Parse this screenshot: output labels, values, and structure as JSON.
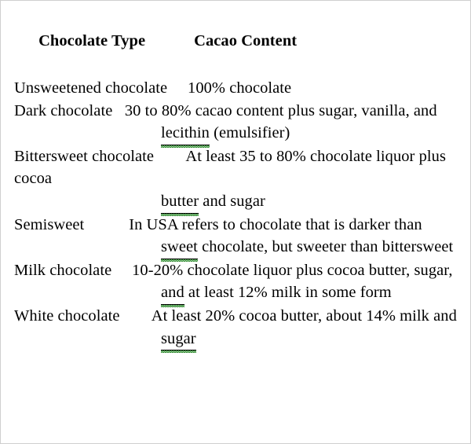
{
  "document": {
    "type": "table",
    "title_row": {
      "col1": "Chocolate Type",
      "col2": "Cacao Content"
    },
    "lines": [
      {
        "id": "line-unsweetened",
        "indent": "none",
        "segments": [
          {
            "text": "Unsweetened chocolate     100% chocolate",
            "spellcheck": false
          }
        ]
      },
      {
        "id": "line-dark-1",
        "indent": "none",
        "segments": [
          {
            "text": "Dark chocolate   30 to 80% cacao content plus sugar, vanilla, and",
            "spellcheck": false
          }
        ]
      },
      {
        "id": "line-dark-2",
        "indent": "hanging",
        "segments": [
          {
            "text": "lecithin",
            "spellcheck": true
          },
          {
            "text": " (emulsifier)",
            "spellcheck": false
          }
        ]
      },
      {
        "id": "line-bittersweet-1",
        "indent": "none",
        "segments": [
          {
            "text": "Bittersweet chocolate        At least 35 to 80% chocolate liquor plus cocoa",
            "spellcheck": false
          }
        ]
      },
      {
        "id": "line-bittersweet-2",
        "indent": "hanging",
        "segments": [
          {
            "text": "butter",
            "spellcheck": true
          },
          {
            "text": " and sugar",
            "spellcheck": false
          }
        ]
      },
      {
        "id": "line-semisweet-1",
        "indent": "none",
        "segments": [
          {
            "text": "Semisweet           In USA refers to chocolate that is darker than",
            "spellcheck": false
          }
        ]
      },
      {
        "id": "line-semisweet-2",
        "indent": "hanging",
        "segments": [
          {
            "text": "sweet",
            "spellcheck": true
          },
          {
            "text": " chocolate, but sweeter than bittersweet",
            "spellcheck": false
          }
        ]
      },
      {
        "id": "line-milk-1",
        "indent": "none",
        "segments": [
          {
            "text": "Milk chocolate     10-20% chocolate liquor plus cocoa butter, sugar,",
            "spellcheck": false
          }
        ]
      },
      {
        "id": "line-milk-2",
        "indent": "hanging",
        "segments": [
          {
            "text": "and",
            "spellcheck": true
          },
          {
            "text": " at least 12% milk in some form",
            "spellcheck": false
          }
        ]
      },
      {
        "id": "line-white-1",
        "indent": "none",
        "segments": [
          {
            "text": "White chocolate        At least 20% cocoa butter, about 14% milk and",
            "spellcheck": false
          }
        ]
      },
      {
        "id": "line-white-2",
        "indent": "hanging",
        "segments": [
          {
            "text": "sugar",
            "spellcheck": true
          }
        ]
      }
    ],
    "table_data": {
      "columns": [
        "Chocolate Type",
        "Cacao Content"
      ],
      "rows": [
        {
          "chocolate_type": "Unsweetened chocolate",
          "cacao_content": "100% chocolate"
        },
        {
          "chocolate_type": "Dark chocolate",
          "cacao_content": "30 to 80% cacao content plus sugar, vanilla, and lecithin (emulsifier)"
        },
        {
          "chocolate_type": "Bittersweet chocolate",
          "cacao_content": "At least 35 to 80% chocolate liquor plus cocoa butter and sugar"
        },
        {
          "chocolate_type": "Semisweet",
          "cacao_content": "In USA refers to chocolate that is darker than sweet chocolate, but sweeter than bittersweet"
        },
        {
          "chocolate_type": "Milk chocolate",
          "cacao_content": "10-20% chocolate liquor plus cocoa butter, sugar, and at least 12% milk in some form"
        },
        {
          "chocolate_type": "White chocolate",
          "cacao_content": "At least 20% cocoa butter, about 14% milk and sugar"
        }
      ]
    },
    "colors": {
      "text": "#000000",
      "spellcheck_squiggle": "#2f8b2f",
      "page_border": "#cfcfcf",
      "background": "#ffffff"
    }
  }
}
